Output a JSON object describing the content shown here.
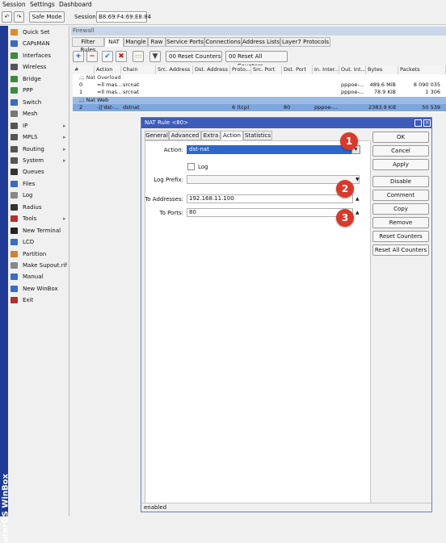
{
  "menu": [
    "Session",
    "Settings",
    "Dashboard"
  ],
  "toolbar": {
    "safe_mode": "Safe Mode",
    "session_label": "Session:",
    "session_value": "B8:69:F4:69:E8:84"
  },
  "brand": "uterOS WinBox",
  "sidebar": {
    "items": [
      {
        "label": "Quick Set",
        "icon": "quick-set-icon",
        "color": "#e08a2a"
      },
      {
        "label": "CAPsMAN",
        "icon": "capsman-icon",
        "color": "#3a6cc0"
      },
      {
        "label": "Interfaces",
        "icon": "interfaces-icon",
        "color": "#3d8a3d"
      },
      {
        "label": "Wireless",
        "icon": "wireless-icon",
        "color": "#555"
      },
      {
        "label": "Bridge",
        "icon": "bridge-icon",
        "color": "#3d8a3d"
      },
      {
        "label": "PPP",
        "icon": "ppp-icon",
        "color": "#3d8a3d"
      },
      {
        "label": "Switch",
        "icon": "switch-icon",
        "color": "#3a6cc0"
      },
      {
        "label": "Mesh",
        "icon": "mesh-icon",
        "color": "#777"
      },
      {
        "label": "IP",
        "icon": "ip-icon",
        "color": "#555",
        "arrow": true
      },
      {
        "label": "MPLS",
        "icon": "mpls-icon",
        "color": "#555",
        "arrow": true
      },
      {
        "label": "Routing",
        "icon": "routing-icon",
        "color": "#555",
        "arrow": true
      },
      {
        "label": "System",
        "icon": "system-icon",
        "color": "#555",
        "arrow": true
      },
      {
        "label": "Queues",
        "icon": "queues-icon",
        "color": "#333"
      },
      {
        "label": "Files",
        "icon": "files-icon",
        "color": "#3a6cc0"
      },
      {
        "label": "Log",
        "icon": "log-icon",
        "color": "#888"
      },
      {
        "label": "Radius",
        "icon": "radius-icon",
        "color": "#333"
      },
      {
        "label": "Tools",
        "icon": "tools-icon",
        "color": "#b03030",
        "arrow": true
      },
      {
        "label": "New Terminal",
        "icon": "terminal-icon",
        "color": "#222"
      },
      {
        "label": "LCD",
        "icon": "lcd-icon",
        "color": "#3a6cc0"
      },
      {
        "label": "Partition",
        "icon": "partition-icon",
        "color": "#d08030"
      },
      {
        "label": "Make Supout.rif",
        "icon": "supout-icon",
        "color": "#888"
      },
      {
        "label": "Manual",
        "icon": "manual-icon",
        "color": "#3a6cc0"
      },
      {
        "label": "New WinBox",
        "icon": "winbox-icon",
        "color": "#3a6cc0"
      },
      {
        "label": "Exit",
        "icon": "exit-icon",
        "color": "#b03030"
      }
    ]
  },
  "firewall": {
    "title": "Firewall",
    "tabs": [
      "Filter Rules",
      "NAT",
      "Mangle",
      "Raw",
      "Service Ports",
      "Connections",
      "Address Lists",
      "Layer7 Protocols"
    ],
    "reset_counters": "Reset Counters",
    "reset_all_counters": "Reset All Counters",
    "columns": [
      "#",
      "Action",
      "Chain",
      "Src. Address",
      "Dst. Address",
      "Proto...",
      "Src. Port",
      "Dst. Port",
      "In. Inter...",
      "Out. Int...",
      "Bytes",
      "Packets"
    ],
    "comment1": ";;; Nat Overload",
    "rows": [
      {
        "num": "0",
        "action": "=ll mas...",
        "chain": "srcnat",
        "proto": "",
        "dport": "",
        "inif": "",
        "outif": "pppoe-...",
        "bytes": "489.6 MiB",
        "packets": "8 090 035"
      },
      {
        "num": "1",
        "action": "=ll mas...",
        "chain": "srcnat",
        "proto": "",
        "dport": "",
        "inif": "",
        "outif": "pppoe-...",
        "bytes": "78.9 KiB",
        "packets": "1 306"
      }
    ],
    "comment2": ";;; Nat Web",
    "selected_row": {
      "num": "2",
      "action": "-||'dst-...",
      "chain": "dstnat",
      "proto": "6 (tcp)",
      "dport": "80",
      "inif": "pppoe-...",
      "outif": "",
      "bytes": "2383.9 KiB",
      "packets": "50 539"
    }
  },
  "dialog": {
    "title": "NAT Rule <80>",
    "tabs": [
      "General",
      "Advanced",
      "Extra",
      "Action",
      "Statistics"
    ],
    "action_label": "Action:",
    "action_value": "dst-nat",
    "log_label": "Log",
    "log_prefix_label": "Log Prefix:",
    "log_prefix_value": "",
    "to_addresses_label": "To Addresses:",
    "to_addresses_value": "192.168.11.100",
    "to_ports_label": "To Ports:",
    "to_ports_value": "80",
    "buttons": [
      "OK",
      "Cancel",
      "Apply",
      "Disable",
      "Comment",
      "Copy",
      "Remove",
      "Reset Counters",
      "Reset All Counters"
    ],
    "status": "enabled",
    "badges": [
      "1",
      "2",
      "3"
    ]
  },
  "colors": {
    "accent": "#3d5bb8",
    "selection": "#7ea6dc",
    "badge": "#d9392b",
    "brand": "#1f3a93"
  }
}
